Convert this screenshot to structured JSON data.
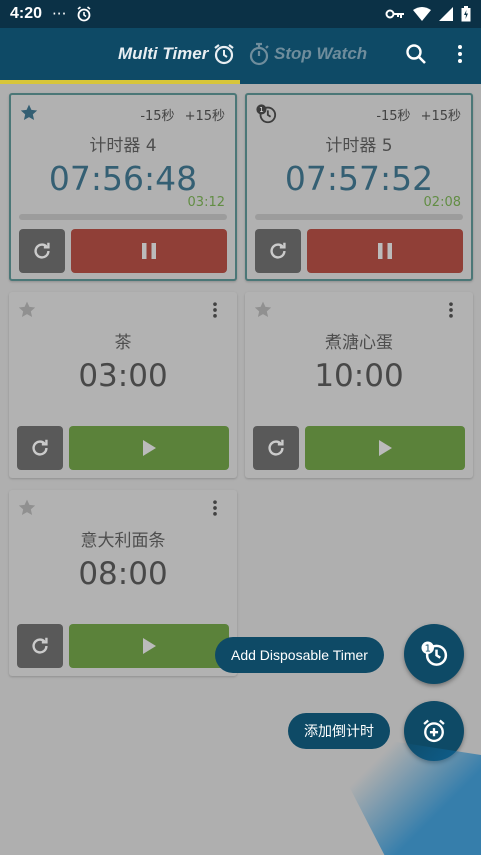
{
  "status_bar": {
    "time": "4:20",
    "dots": "···"
  },
  "app_bar": {
    "tab_multi": "Multi Timer",
    "tab_stop": "Stop Watch"
  },
  "timers": [
    {
      "name": "计时器 4",
      "time": "07:56:48",
      "elapsed": "03:12",
      "minus": "-15秒",
      "plus": "+15秒",
      "state": "running",
      "progress": 0.0
    },
    {
      "name": "计时器 5",
      "time": "07:57:52",
      "elapsed": "02:08",
      "minus": "-15秒",
      "plus": "+15秒",
      "state": "running",
      "progress": 0.0
    },
    {
      "name": "茶",
      "time": "03:00",
      "state": "stopped"
    },
    {
      "name": "煮溏心蛋",
      "time": "10:00",
      "state": "stopped"
    },
    {
      "name": "意大利面条",
      "time": "08:00",
      "state": "stopped"
    }
  ],
  "fab": {
    "add_disposable_label": "Add Disposable Timer",
    "add_countdown_label": "添加倒计时"
  },
  "colors": {
    "app_bar": "#0e4a66",
    "status_bar": "#0b3146",
    "tab_indicator": "#d8c63a",
    "pause_button": "#8e1e12",
    "play_button": "#447a17",
    "reset_button": "#424242",
    "elapsed_text": "#4e8a25"
  }
}
